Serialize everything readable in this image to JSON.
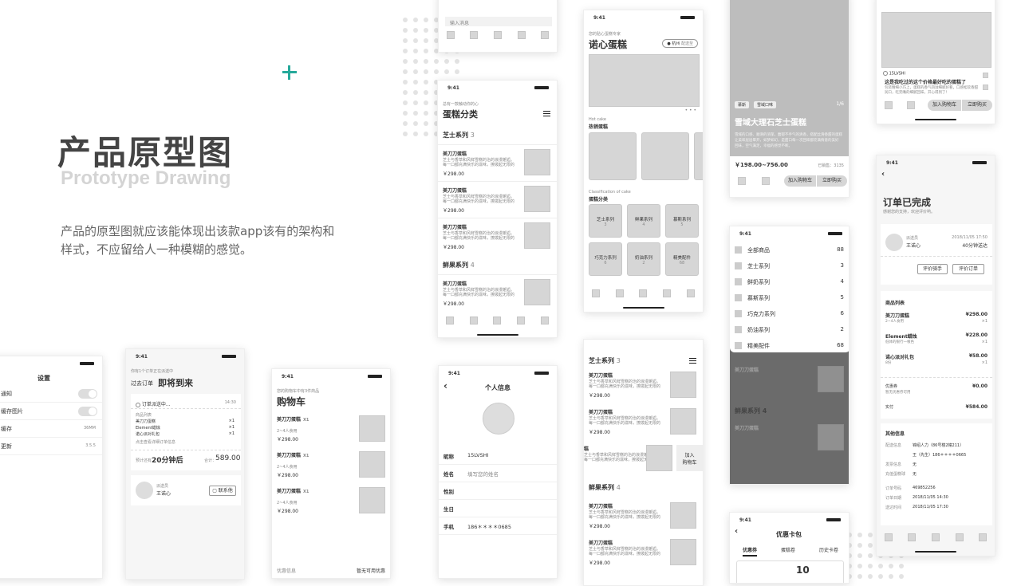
{
  "title": {
    "cn": "产品原型图",
    "en": "Prototype Drawing",
    "desc1": "产品的原型图就应该能体现出该款app该有的架构和",
    "desc2": "样式，不应留给人一种模糊的感觉。"
  },
  "colors": {
    "accent": "#26a99a",
    "placeholder": "#d6d6d6",
    "dark_overlay": "#6b6b6b"
  },
  "time": "9:41",
  "category": {
    "hint": "总有一款触动你的心",
    "title": "蛋糕分类",
    "series1": "芝士系列",
    "series1_count": "3",
    "series2": "鲜果系列",
    "series2_count": "4",
    "item_name": "美刀刀蛋糕",
    "item_desc1": "芝士与香草和风鲜雪糕的治的浪漫邂逅。",
    "item_desc2": "每一口都充满快乐的滋味，撩拨起无限的",
    "price": "￥298.00"
  },
  "message": {
    "placeholder": "输入消息"
  },
  "home": {
    "hint": "您的贴心蛋糕专家",
    "title": "诺心蛋糕",
    "city": "杭州",
    "city_tag": "配送至",
    "hot_en": "Hot cake",
    "hot_cn": "热销蛋糕",
    "cls_en": "Classification of cake",
    "cls_cn": "蛋糕分类",
    "cats": [
      {
        "name": "芝士系列",
        "count": "3"
      },
      {
        "name": "鲜果系列",
        "count": "4"
      },
      {
        "name": "慕斯系列",
        "count": "5"
      },
      {
        "name": "巧克力系列",
        "count": "6"
      },
      {
        "name": "奶油系列",
        "count": "2"
      },
      {
        "name": "精美配件",
        "count": "68"
      }
    ]
  },
  "detail": {
    "tag1": "慕斯",
    "tag2": "雪域口味",
    "page": "1/6",
    "name": "雪域大理石芝士蛋糕",
    "desc1": "雪域的口感、顺滑的浓郁，馥郁不手气的清香，搭配丝滑香甜的蛋糕",
    "desc2": "让美味层层晕开，如梦如幻，是甜口每一次回味都充满情意的美好",
    "desc3": "回味，空气满足，幸福的感觉不断。",
    "price": "￥198.00~756.00",
    "sold": "已销售：3135",
    "cart_btn": "加入购物车",
    "buy_btn": "立即购买"
  },
  "review": {
    "user": "15LVSHI",
    "title": "这是我吃过的这个价格最好吃的蛋糕了",
    "desc1": "包装精细小巧上，蛋糕的香气四溢细腻好看，口感松软香甜",
    "desc2": "润口，吃完嘴的细腻回味，开心得到了！",
    "cart_btn": "加入购物车",
    "buy_btn": "立即购买"
  },
  "order": {
    "title": "订单已完成",
    "subtitle": "感谢您的支持，欢迎评价哟。",
    "courier_label": "派送员",
    "courier": "王诺心",
    "time": "2018/11/05 17:50",
    "speed": "40分钟送达",
    "btn1": "评价骑手",
    "btn2": "评价订单",
    "list_title": "商品列表",
    "items": [
      {
        "name": "美刀刀蛋糕",
        "sub": "2~4人食用",
        "price": "¥298.00",
        "qty": "×1"
      },
      {
        "name": "Element蜡烛",
        "sub": "低体的银行一根色",
        "price": "¥228.00",
        "qty": "×1"
      },
      {
        "name": "诺心派对礼包",
        "sub": "8份",
        "price": "¥58.00",
        "qty": "×1"
      }
    ],
    "coupon_label": "优惠券",
    "coupon_sub": "暂无优惠券可用",
    "coupon": "¥0.00",
    "paid_label": "实付",
    "paid": "¥584.00",
    "other_title": "其他信息",
    "info": [
      {
        "k": "配送信息",
        "v": "锦绍人力（86号楼2幢211）"
      },
      {
        "k": "",
        "v": "王（先生）186＊＊＊＊0665"
      },
      {
        "k": "发票信息",
        "v": "无"
      },
      {
        "k": "充值蛋糕球",
        "v": "无"
      },
      {
        "k": "订单号码",
        "v": "469852256"
      },
      {
        "k": "订单日期",
        "v": "2018/11/05 14:30"
      },
      {
        "k": "送达时间",
        "v": "2018/11/05 17:30"
      }
    ]
  },
  "filter": {
    "items": [
      {
        "label": "全部商品",
        "count": "88"
      },
      {
        "label": "芝士系列",
        "count": "3"
      },
      {
        "label": "鲜奶系列",
        "count": "4"
      },
      {
        "label": "慕斯系列",
        "count": "5"
      },
      {
        "label": "巧克力系列",
        "count": "6"
      },
      {
        "label": "奶油系列",
        "count": "2"
      },
      {
        "label": "精美配件",
        "count": "68"
      }
    ],
    "under_series": "鲜果系列",
    "under_count": "4"
  },
  "coupon": {
    "title": "优惠卡包",
    "tabs": [
      "优惠券",
      "蛋糕卷",
      "历史卡卷"
    ],
    "amount": "10"
  },
  "settings": {
    "title": "设置",
    "rows": [
      {
        "label": "通知",
        "value": ""
      },
      {
        "label": "缓存图片",
        "value": ""
      },
      {
        "label": "缓存",
        "value": "36MM"
      },
      {
        "label": "更新",
        "value": "3.5.5"
      }
    ]
  },
  "delivery": {
    "hint": "你有1个订单正在派送中",
    "past": "过去订单",
    "title": "即将到来",
    "status": "订单派送中...",
    "status_time": "14:30",
    "list_title": "商品列表",
    "items": [
      {
        "name": "美刀刀蛋糕",
        "qty": "×1"
      },
      {
        "name": "Element蜡烛",
        "qty": "×1"
      },
      {
        "name": "诺心派对礼包",
        "qty": "×1"
      }
    ],
    "details": "点击查看详细订单信息",
    "eta_label": "预计还有",
    "eta": "20分钟后",
    "total_label": "合计：",
    "total": "589.00",
    "courier_label": "派送员",
    "courier": "王诺心",
    "contact": "联系他"
  },
  "cart": {
    "hint": "您的购物车中有3件商品",
    "title": "购物车",
    "item_name": "美刀刀蛋糕",
    "qty": "X1",
    "sub": "2~4人食用",
    "price": "￥298.00",
    "footer_label": "优惠信息",
    "footer_value": "暂无可用优惠"
  },
  "profile": {
    "title": "个人信息",
    "fields": [
      {
        "k": "昵称",
        "v": "15LVSHI"
      },
      {
        "k": "姓名",
        "v": "填写您的姓名"
      },
      {
        "k": "性别",
        "v": ""
      },
      {
        "k": "生日",
        "v": ""
      },
      {
        "k": "手机",
        "v": "186＊＊＊＊0685"
      }
    ]
  },
  "list2": {
    "series1": "芝士系列",
    "series1_count": "3",
    "series2": "鲜果系列",
    "series2_count": "4",
    "add": "加入",
    "add2": "购物车"
  }
}
